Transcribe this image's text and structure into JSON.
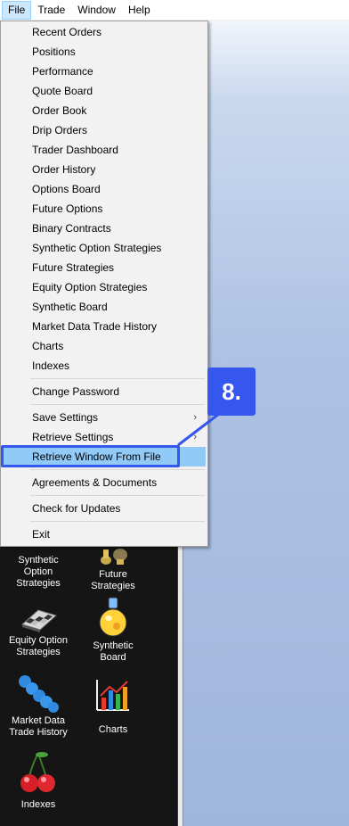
{
  "menubar": {
    "items": [
      {
        "label": "File"
      },
      {
        "label": "Trade"
      },
      {
        "label": "Window"
      },
      {
        "label": "Help"
      }
    ]
  },
  "file_menu": {
    "items": [
      "Recent Orders",
      "Positions",
      "Performance",
      "Quote Board",
      "Order Book",
      "Drip Orders",
      "Trader Dashboard",
      "Order History",
      "Options Board",
      "Future Options",
      "Binary Contracts",
      "Synthetic Option Strategies",
      "Future Strategies",
      "Equity Option Strategies",
      "Synthetic Board",
      "Market Data Trade History",
      "Charts",
      "Indexes"
    ],
    "change_password": "Change Password",
    "save_settings": "Save Settings",
    "retrieve_settings": "Retrieve Settings",
    "retrieve_window_from_file": "Retrieve Window From File",
    "agreements": "Agreements & Documents",
    "check_updates": "Check for Updates",
    "exit": "Exit",
    "submenu_arrow": "›"
  },
  "callout": {
    "label": "8.",
    "color": "#3657ee"
  },
  "tiles": {
    "synthetic_option_strategies": "Synthetic\nOption\nStrategies",
    "future_strategies": "Future\nStrategies",
    "equity_option_strategies": "Equity Option\nStrategies",
    "synthetic_board": "Synthetic\nBoard",
    "market_data_trade_history": "Market Data\nTrade History",
    "charts": "Charts",
    "indexes": "Indexes"
  }
}
